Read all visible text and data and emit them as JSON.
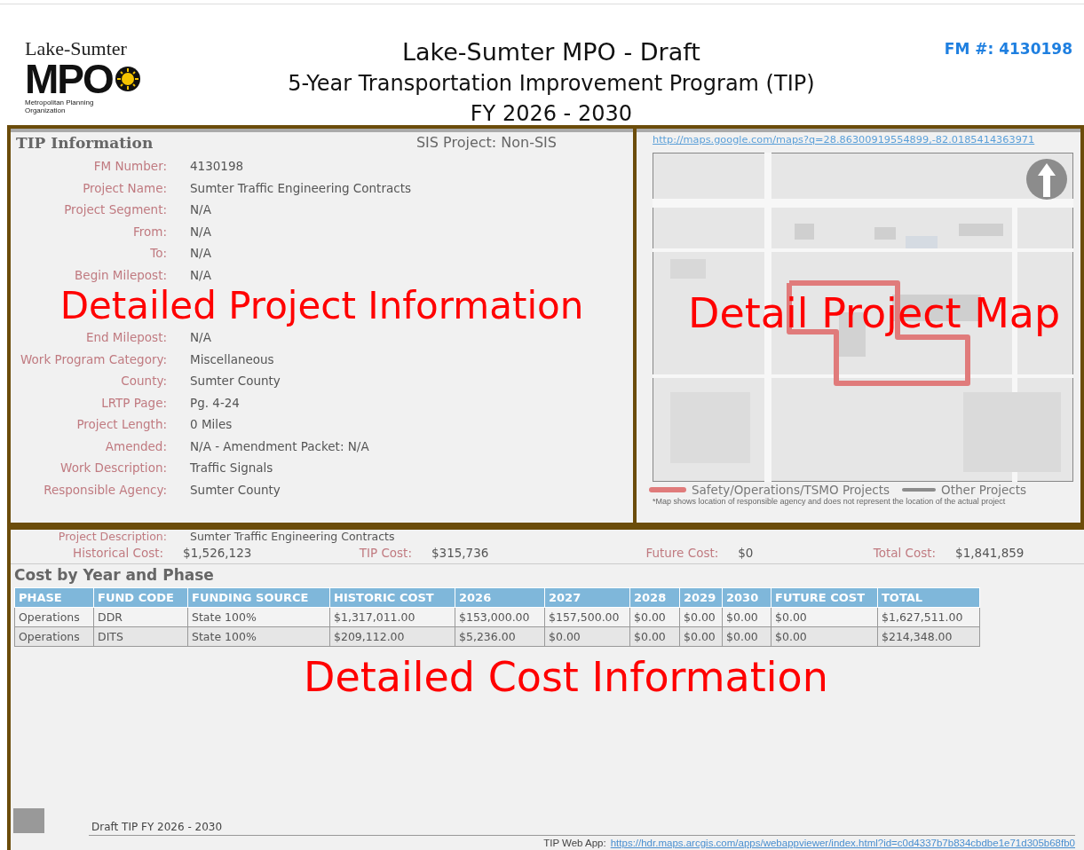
{
  "header": {
    "logo": {
      "top": "Lake-Sumter",
      "mark": "MPO",
      "sub": "Metropolitan Planning Organization"
    },
    "title": "Lake-Sumter MPO - Draft",
    "subtitle": "5-Year Transportation Improvement Program (TIP)",
    "years": "FY 2026 - 2030",
    "fm": "FM #: 4130198"
  },
  "tip_info": {
    "heading": "TIP Information",
    "sis": "SIS Project:  Non-SIS",
    "fields": [
      {
        "label": "FM Number:",
        "value": "4130198"
      },
      {
        "label": "Project Name:",
        "value": "Sumter Traffic Engineering Contracts"
      },
      {
        "label": "Project Segment:",
        "value": "N/A"
      },
      {
        "label": "From:",
        "value": "N/A"
      },
      {
        "label": "To:",
        "value": "N/A"
      },
      {
        "label": "Begin Milepost:",
        "value": "N/A"
      },
      {
        "label": "End Milepost:",
        "value": "N/A"
      },
      {
        "label": "Work Program Category:",
        "value": "Miscellaneous"
      },
      {
        "label": "County:",
        "value": "Sumter County"
      },
      {
        "label": "LRTP Page:",
        "value": "Pg. 4-24"
      },
      {
        "label": "Project Length:",
        "value": "0 Miles"
      },
      {
        "label": "Amended:",
        "value": "N/A - Amendment Packet: N/A"
      },
      {
        "label": "Work Description:",
        "value": "Traffic Signals"
      },
      {
        "label": "Responsible Agency:",
        "value": "Sumter County"
      }
    ]
  },
  "map": {
    "link": "http://maps.google.com/maps?q=28.86300919554899,-82.0185414363971",
    "legend": [
      {
        "label": "Safety/Operations/TSMO Projects",
        "color": "#e07b7b"
      },
      {
        "label": "Other Projects",
        "color": "#8c8c8c"
      }
    ],
    "note": "*Map shows location of responsible agency and does not represent the location of the actual project"
  },
  "project_description": {
    "label": "Project Description:",
    "value": "Sumter Traffic Engineering Contracts"
  },
  "cost_summary": [
    {
      "label": "Historical Cost:",
      "value": "$1,526,123"
    },
    {
      "label": "TIP Cost:",
      "value": "$315,736"
    },
    {
      "label": "Future Cost:",
      "value": "$0"
    },
    {
      "label": "Total Cost:",
      "value": "$1,841,859"
    }
  ],
  "cost_table": {
    "title": "Cost by Year and Phase",
    "columns": [
      "PHASE",
      "FUND CODE",
      "FUNDING SOURCE",
      "HISTORIC COST",
      "2026",
      "2027",
      "2028",
      "2029",
      "2030",
      "FUTURE COST",
      "TOTAL"
    ],
    "rows": [
      [
        "Operations",
        "DDR",
        "State 100%",
        "$1,317,011.00",
        "$153,000.00",
        "$157,500.00",
        "$0.00",
        "$0.00",
        "$0.00",
        "$0.00",
        "$1,627,511.00"
      ],
      [
        "Operations",
        "DITS",
        "State 100%",
        "$209,112.00",
        "$5,236.00",
        "$0.00",
        "$0.00",
        "$0.00",
        "$0.00",
        "$0.00",
        "$214,348.00"
      ]
    ]
  },
  "footer": {
    "draft": "Draft TIP FY 2026 - 2030",
    "web_app_label": "TIP Web App:",
    "web_app_link": "https://hdr.maps.arcgis.com/apps/webappviewer/index.html?id=c0d4337b7b834cbdbe1e71d305b68fb0"
  },
  "annotations": [
    "Detailed Project Information",
    "Detail Project Map",
    "Detailed Cost Information"
  ]
}
